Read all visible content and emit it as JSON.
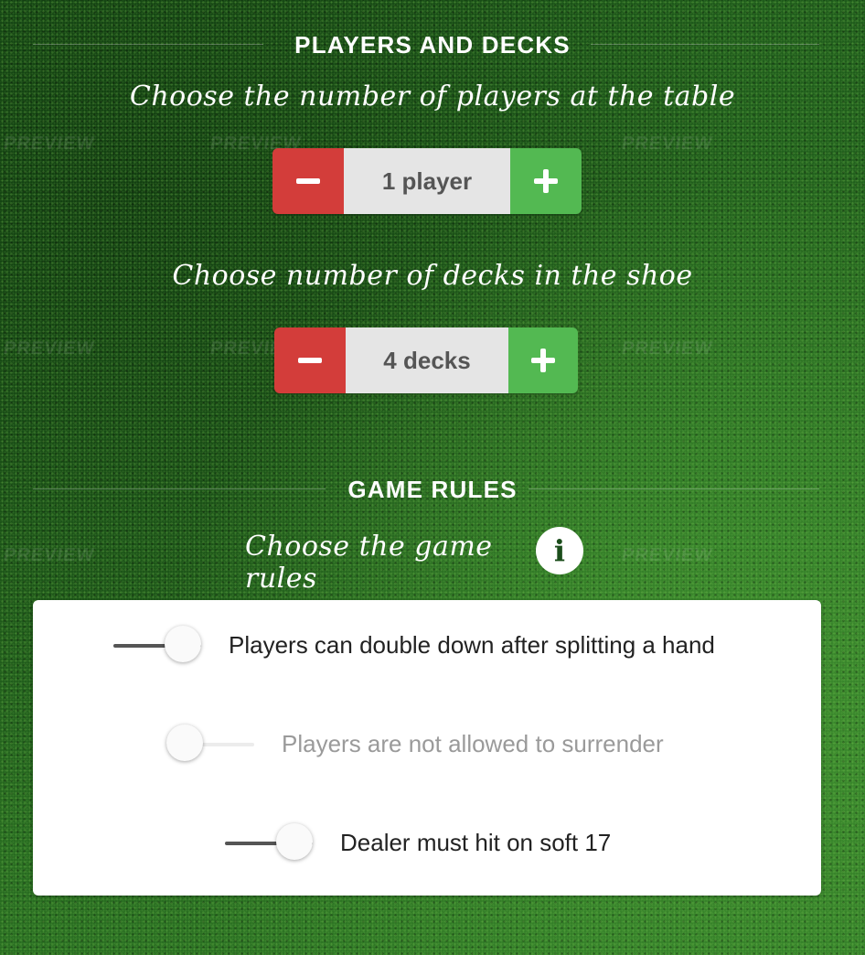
{
  "watermark": "PREVIEW",
  "players_and_decks": {
    "title": "PLAYERS AND DECKS",
    "players_prompt": "Choose the number of players at the table",
    "players_value": "1 player",
    "decks_prompt": "Choose number of decks in the shoe",
    "decks_value": "4 decks"
  },
  "game_rules": {
    "title": "GAME RULES",
    "prompt": "Choose the game rules",
    "info_icon": "i",
    "rules": [
      {
        "label": "Players can double down after splitting a hand",
        "enabled": true
      },
      {
        "label": "Players are not allowed to surrender",
        "enabled": false
      },
      {
        "label": "Dealer must hit on soft 17",
        "enabled": true
      }
    ]
  },
  "colors": {
    "minus_button": "#d33d3a",
    "plus_button": "#53b952",
    "value_field": "#e5e5e5",
    "felt": "#1e5a1a"
  },
  "icons": {
    "minus": "minus-icon",
    "plus": "plus-icon",
    "info": "info-icon"
  }
}
